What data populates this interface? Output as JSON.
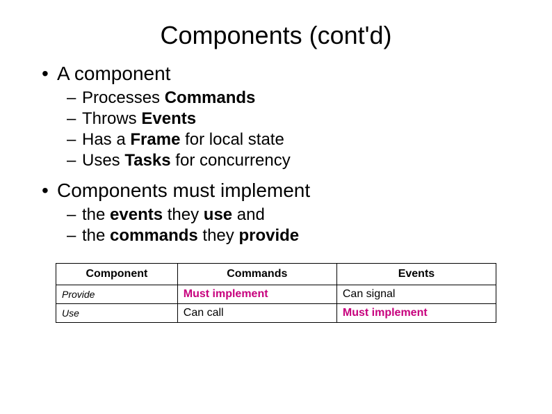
{
  "title": "Components (cont'd)",
  "bullet1": "A component",
  "sub1": {
    "a_pre": "Processes ",
    "a_bold": "Commands",
    "b_pre": "Throws ",
    "b_bold": "Events",
    "c_pre": "Has a ",
    "c_bold": "Frame",
    "c_post": " for local state",
    "d_pre": "Uses ",
    "d_bold": "Tasks",
    "d_post": " for concurrency"
  },
  "bullet2": "Components must implement",
  "sub2": {
    "a_sp": " ",
    "a_pre": "the ",
    "a_bold": "events",
    "a_mid": " they ",
    "a_bold2": "use",
    "a_post": " and",
    "b_pre": "the ",
    "b_bold": "commands",
    "b_mid": " they ",
    "b_bold2": "provide"
  },
  "table": {
    "h1": "Component",
    "h2": "Commands",
    "h3": "Events",
    "r1": {
      "label": "Provide",
      "c1": "Must implement",
      "c2": "Can signal"
    },
    "r2": {
      "label": "Use",
      "c1": "Can call",
      "c2": "Must implement"
    }
  }
}
